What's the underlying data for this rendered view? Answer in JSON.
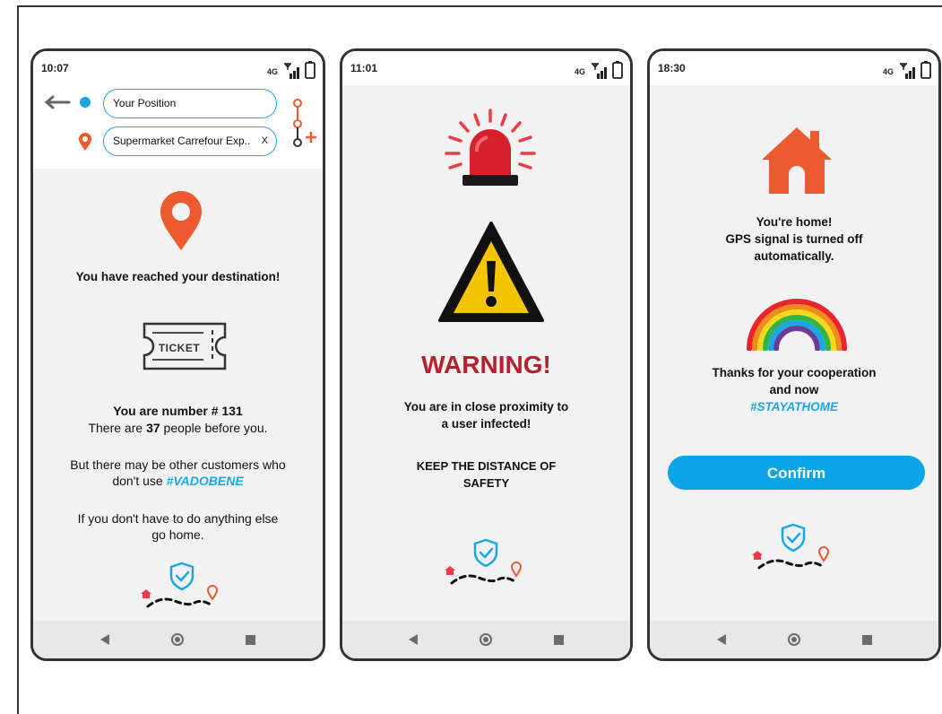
{
  "colors": {
    "accent": "#1aa7e6",
    "orange": "#ee5a30",
    "warning_red": "#b8202e",
    "warning_yellow": "#f5c400"
  },
  "phone1": {
    "time": "10:07",
    "network": "4G",
    "origin_value": "Your Position",
    "destination_value": "Supermarket Carrefour Exp..",
    "clear_label": "X",
    "reached_text": "You have reached your destination!",
    "ticket_label": "TICKET",
    "number_line": "You are number # 131",
    "people_prefix": "There are ",
    "people_count": "37",
    "people_suffix": " people before you.",
    "other_line1": "But there may be other customers who",
    "other_line2_prefix": "don't use ",
    "other_hashtag": "#VADOBENE",
    "home_line1": "If you don't have to do anything else",
    "home_line2": "go home."
  },
  "phone2": {
    "time": "11:01",
    "network": "4G",
    "warning_title": "WARNING!",
    "proximity_line1": "You are in close proximity to",
    "proximity_line2": "a user infected!",
    "keep_line1": "KEEP THE DISTANCE OF",
    "keep_line2": "SAFETY"
  },
  "phone3": {
    "time": "18:30",
    "network": "4G",
    "home_line1": "You're home!",
    "home_line2": "GPS signal is turned off",
    "home_line3": "automatically.",
    "thanks_line1": "Thanks for your cooperation",
    "thanks_line2": "and now",
    "thanks_hashtag": "#STAYATHOME",
    "confirm_label": "Confirm"
  },
  "icons": [
    "back-arrow-icon",
    "origin-dot-icon",
    "destination-pin-icon",
    "swap-route-icon",
    "add-stop-icon",
    "location-pin-icon",
    "ticket-icon",
    "shield-check-icon",
    "home-icon",
    "alarm-siren-icon",
    "warning-triangle-icon",
    "house-icon",
    "rainbow-icon",
    "signal-icon",
    "battery-icon"
  ]
}
